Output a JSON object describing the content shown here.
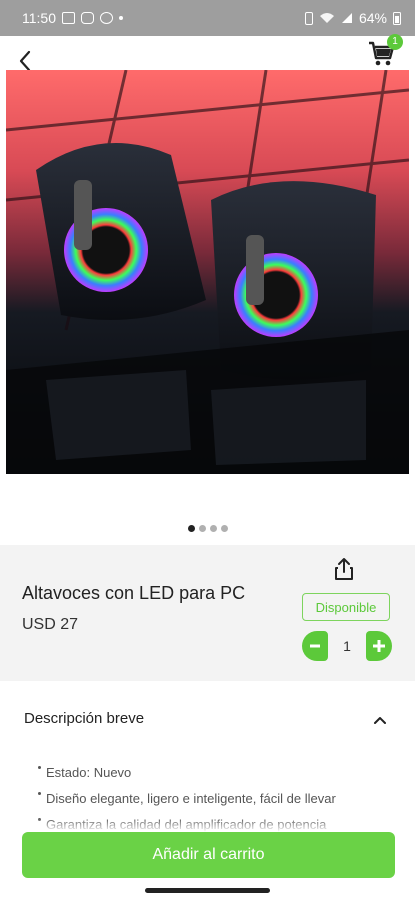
{
  "status_bar": {
    "time": "11:50",
    "battery": "64%"
  },
  "header": {
    "cart_count": "1"
  },
  "product": {
    "title": "Altavoces con LED para PC",
    "price": "USD 27",
    "availability": "Disponible",
    "quantity": "1"
  },
  "pager": {
    "total": 4,
    "active": 1
  },
  "description": {
    "title": "Descripción breve",
    "items": [
      "Estado: Nuevo",
      "Diseño elegante, ligero e inteligente, fácil de llevar",
      "Garantiza la calidad del amplificador de potencia"
    ]
  },
  "actions": {
    "add_to_cart": "Añadir al carrito"
  },
  "colors": {
    "accent": "#5cc93a",
    "button": "#6ad246"
  },
  "icons": {
    "back": "back-arrow-icon",
    "cart": "cart-icon",
    "share": "share-icon",
    "chevron": "chevron-up-icon"
  }
}
